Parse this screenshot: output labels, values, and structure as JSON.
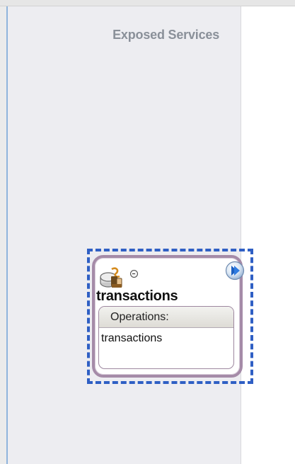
{
  "swimlane": {
    "title": "Exposed Services"
  },
  "service": {
    "name": "transactions",
    "icon": "web-service-icon",
    "collapse_icon": "minus-circle-icon",
    "expand_icon": "chevron-right-circle-icon",
    "operations_label": "Operations:",
    "operations": [
      "transactions"
    ]
  },
  "colors": {
    "selection_border": "#2f5fc4",
    "card_border": "#a58ba8",
    "swimlane_bg": "#ededf1",
    "title_color": "#8a9099"
  }
}
